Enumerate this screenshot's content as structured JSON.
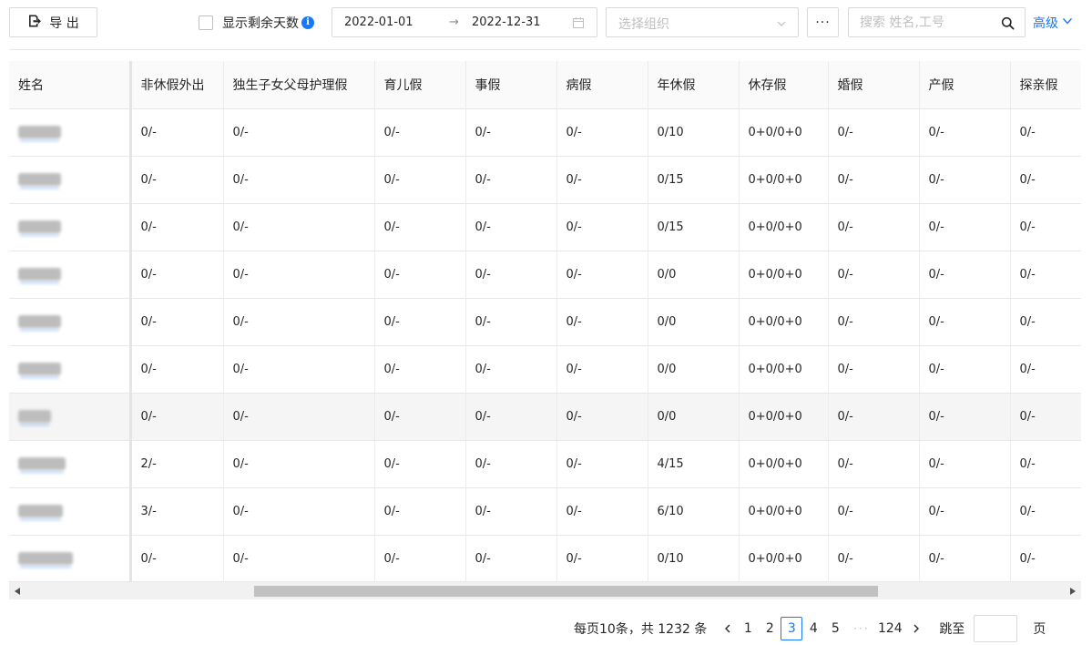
{
  "toolbar": {
    "export_label": "导 出",
    "show_remaining_label": "显示剩余天数",
    "info_glyph": "i",
    "date_start": "2022-01-01",
    "date_separator": "→",
    "date_end": "2022-12-31",
    "org_placeholder": "选择组织",
    "more_label": "···",
    "search_placeholder": "搜索 姓名,工号",
    "advanced_label": "高级"
  },
  "table": {
    "columns": [
      "姓名",
      "非休假外出",
      "独生子女父母护理假",
      "育儿假",
      "事假",
      "病假",
      "年休假",
      "休存假",
      "婚假",
      "产假",
      "探亲假"
    ],
    "rows": [
      {
        "name_blur": 0.9,
        "cells": [
          "0/-",
          "0/-",
          "0/-",
          "0/-",
          "0/-",
          "0/10",
          "0+0/0+0",
          "0/-",
          "0/-",
          "0/-"
        ]
      },
      {
        "name_blur": 0.9,
        "cells": [
          "0/-",
          "0/-",
          "0/-",
          "0/-",
          "0/-",
          "0/15",
          "0+0/0+0",
          "0/-",
          "0/-",
          "0/-"
        ]
      },
      {
        "name_blur": 0.9,
        "cells": [
          "0/-",
          "0/-",
          "0/-",
          "0/-",
          "0/-",
          "0/15",
          "0+0/0+0",
          "0/-",
          "0/-",
          "0/-"
        ]
      },
      {
        "name_blur": 0.9,
        "cells": [
          "0/-",
          "0/-",
          "0/-",
          "0/-",
          "0/-",
          "0/0",
          "0+0/0+0",
          "0/-",
          "0/-",
          "0/-"
        ]
      },
      {
        "name_blur": 0.9,
        "cells": [
          "0/-",
          "0/-",
          "0/-",
          "0/-",
          "0/-",
          "0/0",
          "0+0/0+0",
          "0/-",
          "0/-",
          "0/-"
        ]
      },
      {
        "name_blur": 0.9,
        "cells": [
          "0/-",
          "0/-",
          "0/-",
          "0/-",
          "0/-",
          "0/0",
          "0+0/0+0",
          "0/-",
          "0/-",
          "0/-"
        ]
      },
      {
        "name_blur": 0.7,
        "cells": [
          "0/-",
          "0/-",
          "0/-",
          "0/-",
          "0/-",
          "0/0",
          "0+0/0+0",
          "0/-",
          "0/-",
          "0/-"
        ]
      },
      {
        "name_blur": 1.0,
        "cells": [
          "2/-",
          "0/-",
          "0/-",
          "0/-",
          "0/-",
          "4/15",
          "0+0/0+0",
          "0/-",
          "0/-",
          "0/-"
        ]
      },
      {
        "name_blur": 0.95,
        "cells": [
          "3/-",
          "0/-",
          "0/-",
          "0/-",
          "0/-",
          "6/10",
          "0+0/0+0",
          "0/-",
          "0/-",
          "0/-"
        ]
      },
      {
        "name_blur": 1.15,
        "cells": [
          "0/-",
          "0/-",
          "0/-",
          "0/-",
          "0/-",
          "0/10",
          "0+0/0+0",
          "0/-",
          "0/-",
          "0/-"
        ]
      }
    ],
    "highlighted_row_index": 6
  },
  "scrollbar": {
    "position_fraction": 0.22,
    "visible_fraction": 0.6
  },
  "pagination": {
    "total_text": "每页10条，共 1232 条",
    "pages": [
      "1",
      "2",
      "3",
      "4",
      "5"
    ],
    "current_page": "3",
    "ellipsis": "···",
    "last_page": "124",
    "jump_label": "跳至",
    "jump_value": "",
    "page_suffix": "页"
  },
  "colors": {
    "accent": "#1677ff",
    "border": "#d9d9d9",
    "header_bg": "#fafafa",
    "highlight_row_bg": "#f5f5f5"
  },
  "icons": {
    "export": "export-icon",
    "info": "info-icon",
    "calendar": "calendar-icon",
    "chevron": "chevron-down-icon",
    "search": "search-icon"
  }
}
